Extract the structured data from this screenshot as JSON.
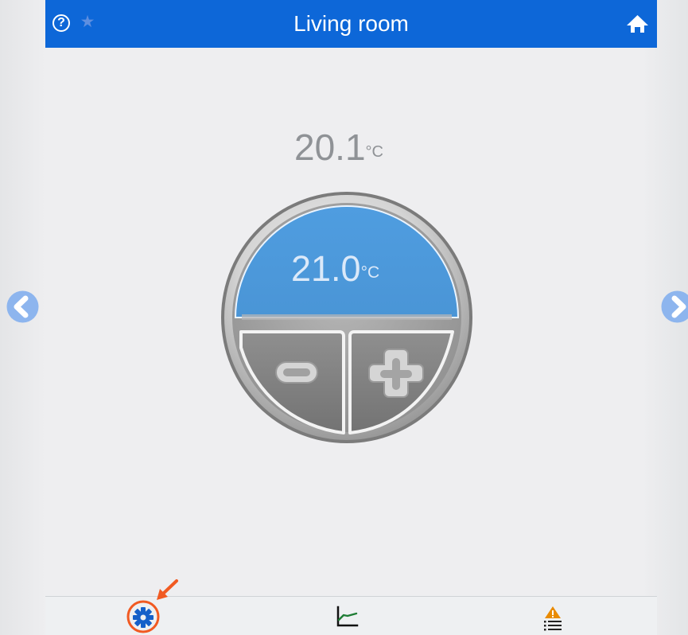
{
  "header": {
    "title": "Living room",
    "help_icon": "question-circle-icon",
    "help_label": "?",
    "favorite_icon": "star-icon",
    "favorite_label": "★",
    "home_icon": "home-icon",
    "accent_color": "#0d67d8"
  },
  "temperature": {
    "current_value": "20.1",
    "current_unit": "°C",
    "setpoint_value": "21.0",
    "setpoint_unit": "°C",
    "setpoint_color": "#4b98d8"
  },
  "controls": {
    "decrease_icon": "minus-icon",
    "increase_icon": "plus-icon"
  },
  "navigation": {
    "previous_icon": "chevron-left-icon",
    "next_icon": "chevron-right-icon",
    "arrow_color": "#93b8f0"
  },
  "bottom_bar": {
    "items": [
      {
        "name": "settings",
        "icon": "gear-icon",
        "color": "#1560c9",
        "highlight_color": "#f15a22"
      },
      {
        "name": "chart",
        "icon": "line-chart-icon",
        "color": "#1e7d35"
      },
      {
        "name": "alerts",
        "icon": "warning-list-icon",
        "color": "#e98b00"
      }
    ]
  }
}
